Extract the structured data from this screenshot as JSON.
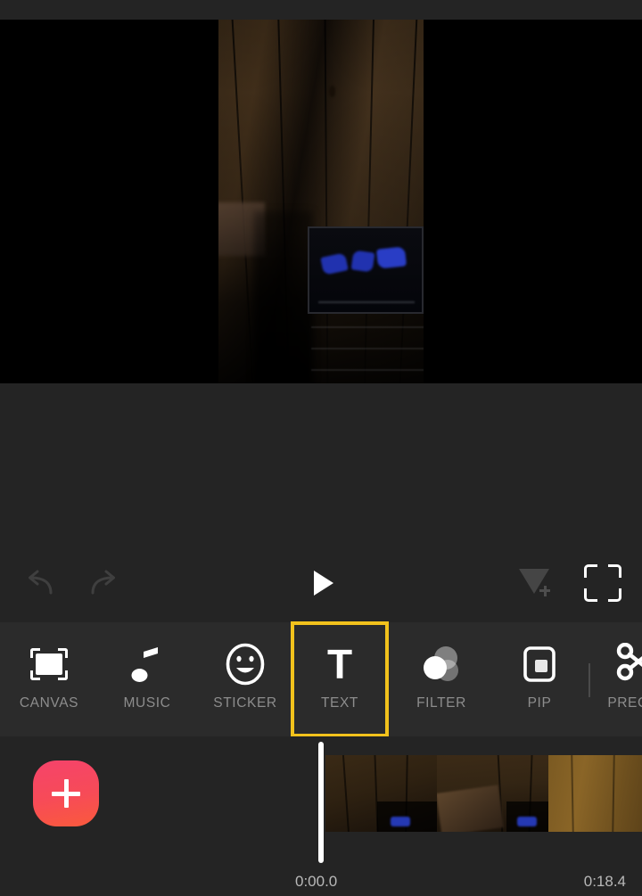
{
  "app": {
    "name": "video-editor",
    "theme_background": "#242424",
    "accent_yellow": "#F2C21C",
    "accent_red_start": "#F5436B",
    "accent_red_end": "#FA5A3C"
  },
  "preview": {
    "name": "video-preview",
    "scene_description": "dark wooden plank wall with a dark box containing blue items",
    "letterbox_color": "#000000"
  },
  "player_controls": {
    "undo": {
      "label": "undo",
      "icon": "undo-arrow-icon",
      "enabled": false
    },
    "redo": {
      "label": "redo",
      "icon": "redo-arrow-icon",
      "enabled": false
    },
    "play": {
      "label": "play",
      "icon": "play-triangle-icon",
      "enabled": true
    },
    "keyframe": {
      "label": "add keyframe",
      "icon": "keyframe-add-icon",
      "enabled": false
    },
    "fullscreen": {
      "label": "fullscreen",
      "icon": "fullscreen-expand-icon",
      "enabled": true
    }
  },
  "toolbar": {
    "selected": "TEXT",
    "items": [
      {
        "label": "CANVAS",
        "icon": "canvas-crop-icon"
      },
      {
        "label": "MUSIC",
        "icon": "music-note-icon"
      },
      {
        "label": "STICKER",
        "icon": "smiley-face-icon"
      },
      {
        "label": "TEXT",
        "icon": "text-t-icon"
      },
      {
        "label": "FILTER",
        "icon": "overlapping-circles-icon"
      },
      {
        "label": "PIP",
        "icon": "picture-in-picture-icon"
      },
      {
        "label": "PRECUT",
        "icon": "scissors-icon"
      }
    ]
  },
  "timeline": {
    "add_media_button": {
      "label": "add media",
      "icon": "plus-icon"
    },
    "playhead": {
      "name": "playhead"
    },
    "time_start": "0:00.0",
    "time_end": "0:18.4",
    "clips": [
      {
        "name": "video-clip-thumbnail-1"
      },
      {
        "name": "video-clip-thumbnail-2"
      },
      {
        "name": "video-clip-thumbnail-3"
      }
    ]
  }
}
